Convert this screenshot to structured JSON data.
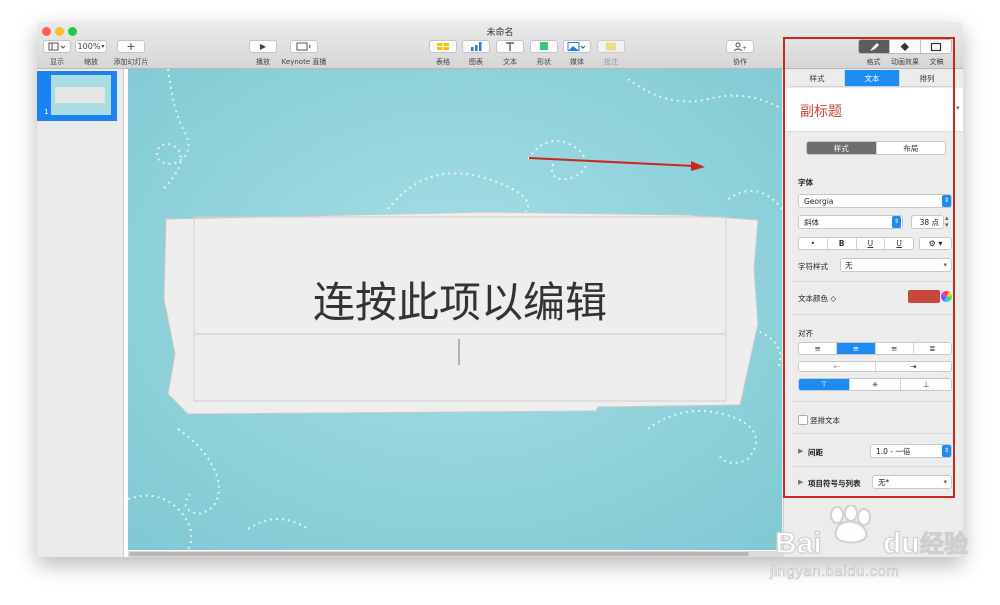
{
  "window": {
    "title": "未命名"
  },
  "toolbar": {
    "view": {
      "label": "显示"
    },
    "zoom": {
      "value": "100%",
      "label": "缩放"
    },
    "add_slide": {
      "label": "添加幻灯片"
    },
    "play": {
      "label": "播放"
    },
    "keynote_live": {
      "label": "Keynote 直播"
    },
    "table": {
      "label": "表格"
    },
    "chart": {
      "label": "图表"
    },
    "text": {
      "label": "文本"
    },
    "shape": {
      "label": "形状"
    },
    "media": {
      "label": "媒体"
    },
    "comment": {
      "label": "批注"
    },
    "collaborate": {
      "label": "协作"
    },
    "format": {
      "label": "格式"
    },
    "animate": {
      "label": "动画效果"
    },
    "document": {
      "label": "文稿"
    }
  },
  "navigator": {
    "slide_number": "1"
  },
  "slide": {
    "title_placeholder": "连按此项以编辑"
  },
  "inspector": {
    "tabs": [
      "样式",
      "文本",
      "排列"
    ],
    "active_tab": "文本",
    "paragraph_style": "副标题",
    "subtabs": [
      "样式",
      "布局"
    ],
    "font_section": "字体",
    "font_family": "Georgia",
    "font_typeface": "斜体",
    "font_size": "38 点",
    "style_buttons": [
      "•",
      "B",
      "U",
      "U"
    ],
    "character_style_label": "字符样式",
    "character_style_value": "无",
    "text_color_label": "文本颜色 ◇",
    "text_color": "#c8463c",
    "alignment_section": "对齐",
    "vertical_text_label": "竖排文本",
    "spacing_label": "间距",
    "spacing_value": "1.0 - 一倍",
    "bullets_label": "项目符号与列表",
    "bullets_value": "无*"
  },
  "colors": {
    "highlight": "#c8281e",
    "accent": "#1c8cf2"
  },
  "watermark": {
    "brand": "Baidu经验",
    "url": "jingyan.baidu.com"
  }
}
